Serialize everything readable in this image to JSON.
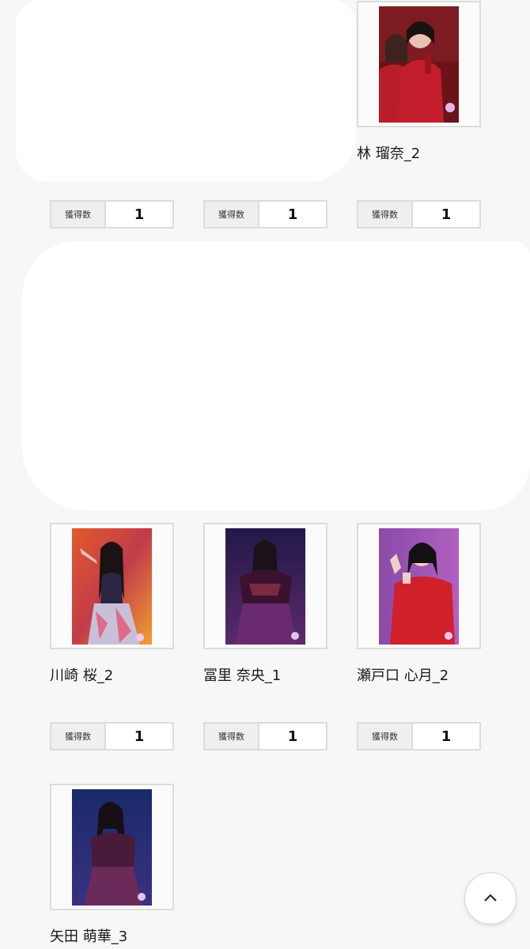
{
  "count_label": "獲得数",
  "members": {
    "hayashi": {
      "name": "林 瑠奈_2",
      "count": "1"
    },
    "kawasaki": {
      "name": "川崎 桜_2",
      "count": "1"
    },
    "tomisato": {
      "name": "冨里 奈央_1",
      "count": "1"
    },
    "setoguchi": {
      "name": "瀬戸口 心月_2",
      "count": "1"
    },
    "yata": {
      "name": "矢田 萌華_3"
    }
  },
  "hidden_counts": {
    "first": "1",
    "second": "1"
  },
  "icons": {
    "back_to_top": "chevron-up-icon"
  }
}
